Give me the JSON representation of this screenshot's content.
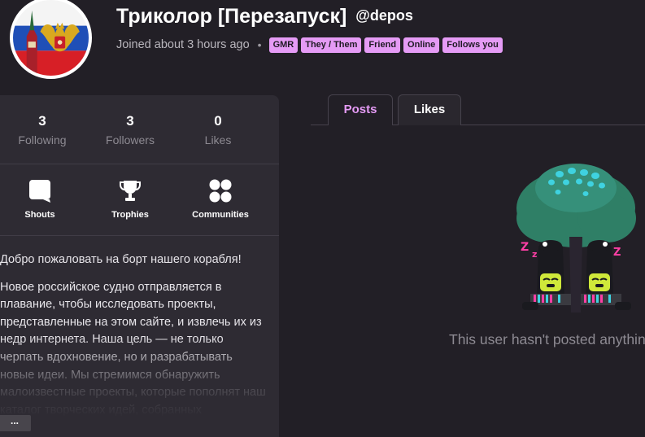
{
  "profile": {
    "display_name": "Триколор [Перезапуск]",
    "username": "@depos",
    "joined": "Joined about 3 hours ago",
    "separator": "•",
    "badges": [
      "GMR",
      "They / Them",
      "Friend",
      "Online",
      "Follows you"
    ]
  },
  "stats": [
    {
      "value": "3",
      "label": "Following"
    },
    {
      "value": "3",
      "label": "Followers"
    },
    {
      "value": "0",
      "label": "Likes"
    }
  ],
  "nav": [
    {
      "label": "Shouts",
      "icon": "speech-bubble-icon"
    },
    {
      "label": "Trophies",
      "icon": "trophy-icon"
    },
    {
      "label": "Communities",
      "icon": "communities-icon"
    }
  ],
  "bio": {
    "paragraphs": [
      "Добро пожаловать на борт нашего корабля!",
      "Новое российское судно отправляется в плавание, чтобы исследовать проекты, представленные на этом сайте, и извлечь их из недр интернета. Наша цель — не только черпать вдохновение, но и разрабатывать новые идеи. Мы стремимся обнаружить малоизвестные проекты, которые пополнят наш каталог творческих идей, собранных"
    ],
    "more_label": "..."
  },
  "tabs": [
    {
      "label": "Posts",
      "active": true
    },
    {
      "label": "Likes",
      "active": false
    }
  ],
  "empty_state": {
    "message": "This user hasn't posted anything yet"
  },
  "colors": {
    "background": "#221f26",
    "card": "#2e2b33",
    "accent": "#e59bf5",
    "muted_text": "#8d8a92"
  }
}
